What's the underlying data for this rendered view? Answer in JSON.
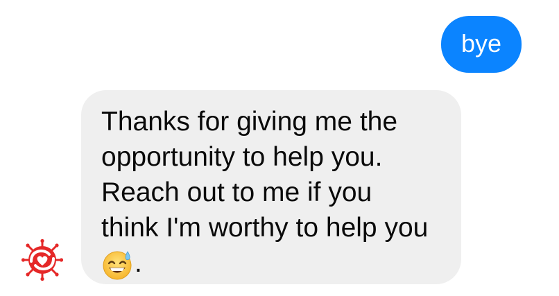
{
  "conversation": {
    "outgoing": [
      {
        "text": "bye"
      }
    ],
    "incoming": [
      {
        "lines": [
          "Thanks for giving me the",
          "opportunity to help you.",
          "Reach out to me if you",
          "think I'm worthy to help you"
        ],
        "last_line_suffix": ".",
        "emoji": "grinning-face-with-sweat",
        "avatar_icon": "heart-hands-virus-logo-icon"
      }
    ]
  },
  "colors": {
    "outgoing_bubble": "#0b84ff",
    "incoming_bubble": "#efefef",
    "avatar_red": "#e52828"
  }
}
